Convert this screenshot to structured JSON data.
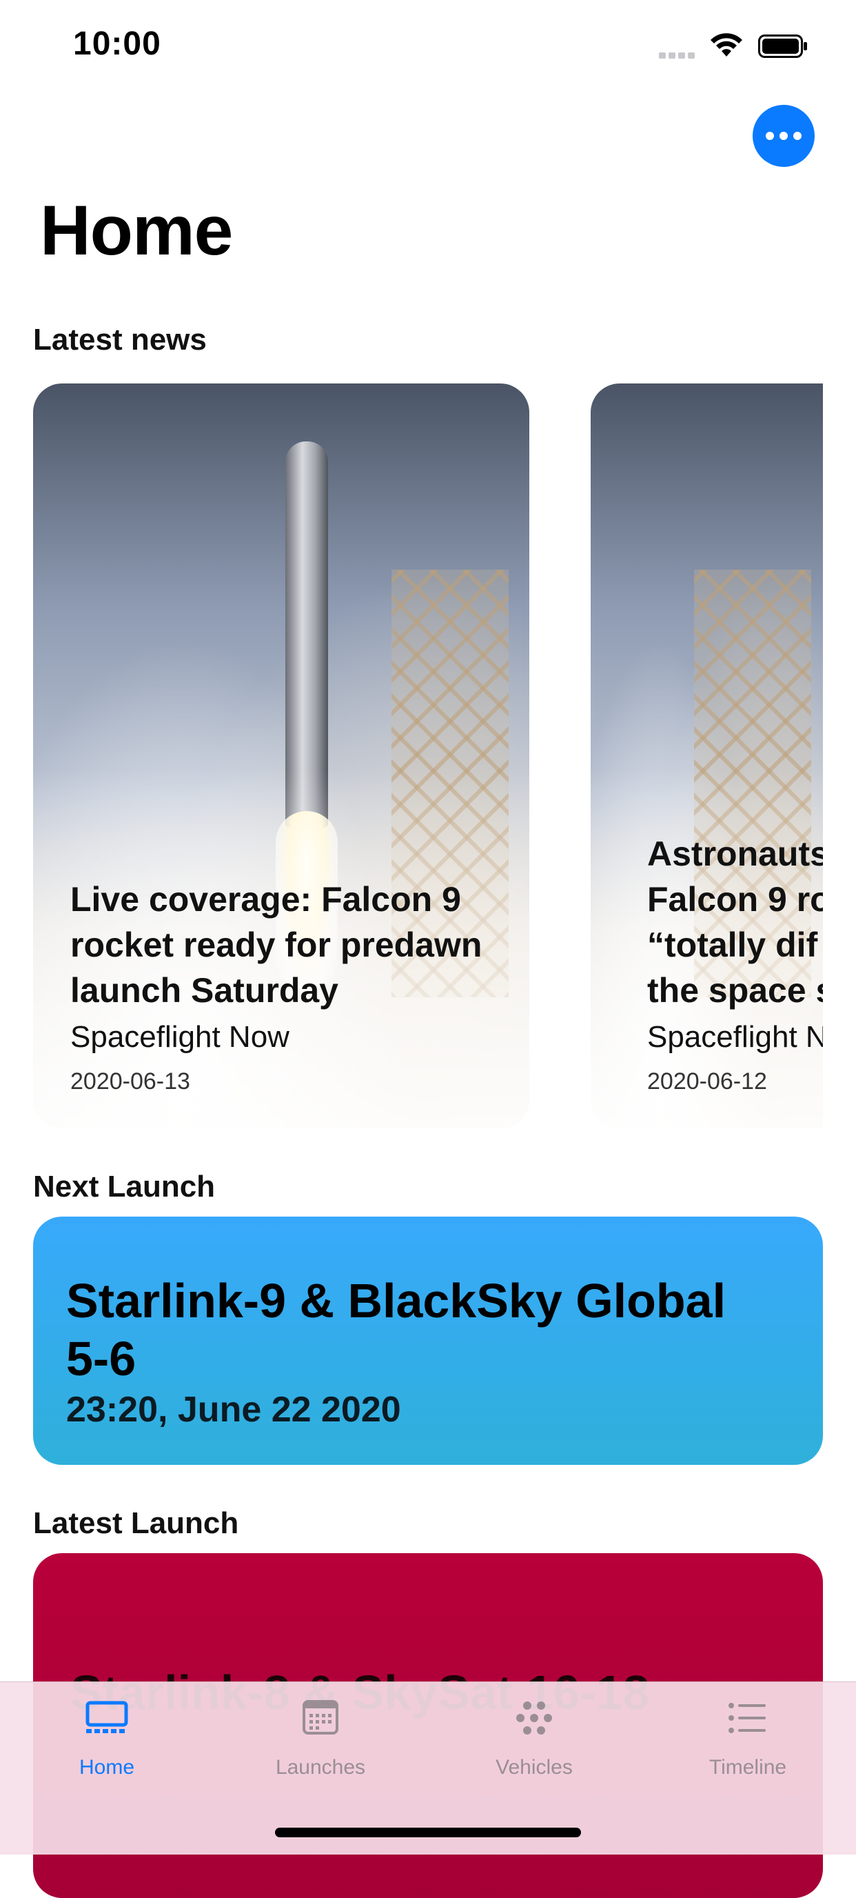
{
  "status_bar": {
    "time": "10:00"
  },
  "header": {
    "title": "Home",
    "more_button_icon": "ellipsis-icon"
  },
  "sections": {
    "latest_news": "Latest news",
    "next_launch": "Next Launch",
    "latest_launch": "Latest Launch"
  },
  "news": [
    {
      "title": "Live coverage: Falcon 9 rocket ready for predawn launch Saturday",
      "source": "Spaceflight Now",
      "date": "2020-06-13"
    },
    {
      "title": "Astronauts Falcon 9 ro “totally dif the space s",
      "source": "Spaceflight N",
      "date": "2020-06-12"
    }
  ],
  "next_launch": {
    "name": "Starlink-9 & BlackSky Global 5-6",
    "date": "23:20, June 22 2020",
    "color": "#38a9fb"
  },
  "latest_launch": {
    "name": "Starlink-8 & SkySat 16-18",
    "color": "#b8003a"
  },
  "tabs": [
    {
      "label": "Home",
      "icon": "display-icon",
      "active": true
    },
    {
      "label": "Launches",
      "icon": "calendar-icon",
      "active": false
    },
    {
      "label": "Vehicles",
      "icon": "engines-icon",
      "active": false
    },
    {
      "label": "Timeline",
      "icon": "list-icon",
      "active": false
    }
  ],
  "colors": {
    "accent": "#0a7aff",
    "tab_bar": "#f6dee8"
  }
}
